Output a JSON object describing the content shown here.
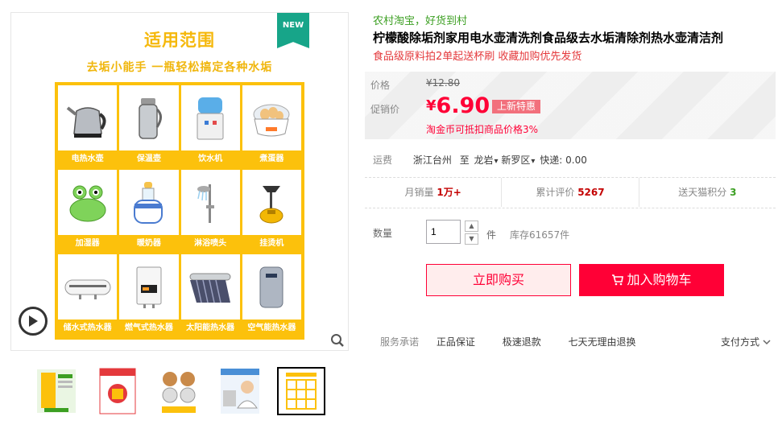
{
  "gallery": {
    "new_badge": "NEW",
    "promo_title": "适用范围",
    "promo_subtitle": "去垢小能手 一瓶轻松搞定各种水垢",
    "appliances": [
      {
        "label": "电热水壶",
        "icon": "kettle"
      },
      {
        "label": "保温壶",
        "icon": "thermos"
      },
      {
        "label": "饮水机",
        "icon": "water-dispenser"
      },
      {
        "label": "煮蛋器",
        "icon": "egg-boiler"
      },
      {
        "label": "加湿器",
        "icon": "humidifier"
      },
      {
        "label": "暖奶器",
        "icon": "bottle-warmer"
      },
      {
        "label": "淋浴喷头",
        "icon": "shower-head"
      },
      {
        "label": "挂烫机",
        "icon": "garment-steamer"
      },
      {
        "label": "储水式热水器",
        "icon": "tank-water-heater"
      },
      {
        "label": "燃气式热水器",
        "icon": "gas-water-heater"
      },
      {
        "label": "太阳能热水器",
        "icon": "solar-water-heater"
      },
      {
        "label": "空气能热水器",
        "icon": "heat-pump-water-heater"
      }
    ],
    "thumbnail_count": 5
  },
  "product": {
    "store_line": "农村淘宝，好货到村",
    "title": "柠檬酸除垢剂家用电水壶清洗剂食品级去水垢清除剂热水壶清洁剂",
    "subtitle": "食品级原料拍2单起送杯刷 收藏加购优先发货"
  },
  "price": {
    "orig_label": "价格",
    "orig_price": "¥12.80",
    "promo_label": "促销价",
    "currency": "¥",
    "promo_price": "6.90",
    "promo_badge": "上新特惠",
    "coin_note": "淘金币可抵扣商品价格3%"
  },
  "shipping": {
    "label": "运费",
    "from": "浙江台州",
    "to_word": "至",
    "city": "龙岩",
    "district": "新罗区",
    "express": "快递: 0.00"
  },
  "stats": {
    "monthly_sales_label": "月销量",
    "monthly_sales": "1万+",
    "reviews_label": "累计评价",
    "reviews": "5267",
    "points_label": "送天猫积分",
    "points": "3"
  },
  "purchase": {
    "qty_label": "数量",
    "qty_value": "1",
    "unit": "件",
    "stock": "库存61657件",
    "buy_label": "立即购买",
    "cart_label": "加入购物车"
  },
  "service": {
    "label": "服务承诺",
    "items": [
      "正品保证",
      "极速退款",
      "七天无理由退换"
    ],
    "payment": "支付方式"
  },
  "colors": {
    "accent": "#ff0036",
    "store_green": "#3c9f22",
    "promo_yellow": "#fcc10c",
    "ribbon_teal": "#17a589"
  }
}
